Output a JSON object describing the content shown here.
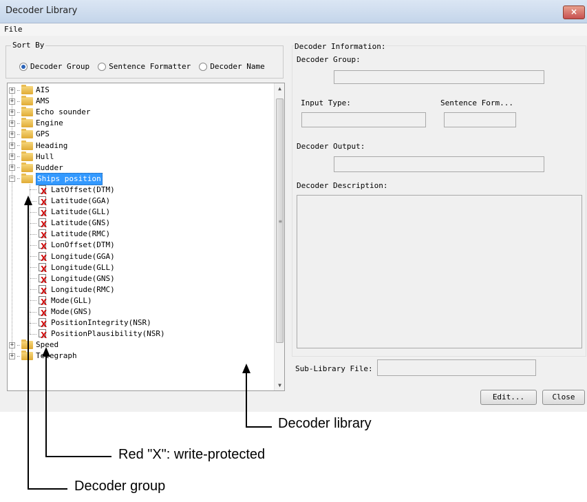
{
  "window": {
    "title": "Decoder Library",
    "close_label": "×"
  },
  "menu": {
    "file": "File"
  },
  "sort": {
    "legend": "Sort By",
    "options": [
      "Decoder Group",
      "Sentence Formatter",
      "Decoder Name"
    ],
    "selected": "Decoder Group"
  },
  "tree": {
    "groups_top": [
      "AIS",
      "AMS",
      "Echo sounder",
      "Engine",
      "GPS",
      "Heading",
      "Hull",
      "Rudder"
    ],
    "expanded_group": "Ships position",
    "decoders": [
      "LatOffset(DTM)",
      "Latitude(GGA)",
      "Latitude(GLL)",
      "Latitude(GNS)",
      "Latitude(RMC)",
      "LonOffset(DTM)",
      "Longitude(GGA)",
      "Longitude(GLL)",
      "Longitude(GNS)",
      "Longitude(RMC)",
      "Mode(GLL)",
      "Mode(GNS)",
      "PositionIntegrity(NSR)",
      "PositionPlausibility(NSR)"
    ],
    "groups_bottom": [
      "Speed",
      "Telegraph"
    ],
    "write_protected_mark": "X"
  },
  "info": {
    "legend": "Decoder Information:",
    "group_label": "Decoder Group:",
    "group_value": "",
    "input_type_label": "Input Type:",
    "input_type_value": "",
    "sentence_label": "Sentence Form...",
    "sentence_value": "",
    "output_label": "Decoder Output:",
    "output_value": "",
    "description_label": "Decoder Description:",
    "description_value": "",
    "sublib_label": "Sub-Library File:",
    "sublib_value": ""
  },
  "buttons": {
    "edit": "Edit...",
    "close": "Close"
  },
  "annotations": {
    "library": "Decoder library",
    "write_protected": "Red \"X\": write-protected",
    "group": "Decoder group"
  },
  "colors": {
    "selection": "#3399ff",
    "protected_x": "#d01010",
    "folder": "#e8b848"
  }
}
